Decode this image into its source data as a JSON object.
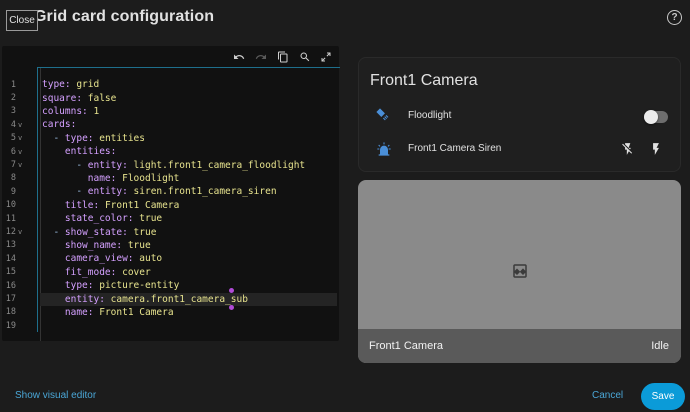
{
  "dialog": {
    "title": "Grid card configuration",
    "close_label": "Close",
    "help_icon": "help-circle-icon"
  },
  "editor": {
    "toolbar_icons": [
      "undo-icon",
      "redo-icon",
      "copy-icon",
      "search-icon",
      "fullscreen-icon"
    ],
    "lines": [
      {
        "n": "1",
        "fold": "",
        "parts": [
          [
            "k",
            "type: "
          ],
          [
            "v",
            "grid"
          ]
        ]
      },
      {
        "n": "2",
        "fold": "",
        "parts": [
          [
            "k",
            "square: "
          ],
          [
            "v",
            "false"
          ]
        ]
      },
      {
        "n": "3",
        "fold": "",
        "parts": [
          [
            "k",
            "columns: "
          ],
          [
            "v",
            "1"
          ]
        ]
      },
      {
        "n": "4",
        "fold": "v",
        "parts": [
          [
            "k",
            "cards:"
          ]
        ]
      },
      {
        "n": "5",
        "fold": "v",
        "parts": [
          [
            "s",
            "  "
          ],
          [
            "d",
            "- "
          ],
          [
            "k",
            "type: "
          ],
          [
            "v",
            "entities"
          ]
        ]
      },
      {
        "n": "6",
        "fold": "v",
        "parts": [
          [
            "s",
            "    "
          ],
          [
            "k",
            "entities:"
          ]
        ]
      },
      {
        "n": "7",
        "fold": "v",
        "parts": [
          [
            "s",
            "      "
          ],
          [
            "d",
            "- "
          ],
          [
            "k",
            "entity: "
          ],
          [
            "v",
            "light.front1_camera_floodlight"
          ]
        ]
      },
      {
        "n": "8",
        "fold": "",
        "parts": [
          [
            "s",
            "        "
          ],
          [
            "k",
            "name: "
          ],
          [
            "v",
            "Floodlight"
          ]
        ]
      },
      {
        "n": "9",
        "fold": "",
        "parts": [
          [
            "s",
            "      "
          ],
          [
            "d",
            "- "
          ],
          [
            "k",
            "entity: "
          ],
          [
            "v",
            "siren.front1_camera_siren"
          ]
        ]
      },
      {
        "n": "10",
        "fold": "",
        "parts": [
          [
            "s",
            "    "
          ],
          [
            "k",
            "title: "
          ],
          [
            "v",
            "Front1 Camera"
          ]
        ]
      },
      {
        "n": "11",
        "fold": "",
        "parts": [
          [
            "s",
            "    "
          ],
          [
            "k",
            "state_color: "
          ],
          [
            "v",
            "true"
          ]
        ]
      },
      {
        "n": "12",
        "fold": "v",
        "parts": [
          [
            "s",
            "  "
          ],
          [
            "d",
            "- "
          ],
          [
            "k",
            "show_state: "
          ],
          [
            "v",
            "true"
          ]
        ]
      },
      {
        "n": "13",
        "fold": "",
        "parts": [
          [
            "s",
            "    "
          ],
          [
            "k",
            "show_name: "
          ],
          [
            "v",
            "true"
          ]
        ]
      },
      {
        "n": "14",
        "fold": "",
        "parts": [
          [
            "s",
            "    "
          ],
          [
            "k",
            "camera_view: "
          ],
          [
            "v",
            "auto"
          ]
        ]
      },
      {
        "n": "15",
        "fold": "",
        "parts": [
          [
            "s",
            "    "
          ],
          [
            "k",
            "fit_mode: "
          ],
          [
            "v",
            "cover"
          ]
        ]
      },
      {
        "n": "16",
        "fold": "",
        "parts": [
          [
            "s",
            "    "
          ],
          [
            "k",
            "type: "
          ],
          [
            "v",
            "picture-entity"
          ]
        ]
      },
      {
        "n": "17",
        "fold": "",
        "parts": [
          [
            "s",
            "    "
          ],
          [
            "k",
            "entity: "
          ],
          [
            "v",
            "camera.front1_camera_sub"
          ]
        ]
      },
      {
        "n": "18",
        "fold": "",
        "parts": [
          [
            "s",
            "    "
          ],
          [
            "k",
            "name: "
          ],
          [
            "v",
            "Front1 Camera"
          ]
        ]
      },
      {
        "n": "19",
        "fold": "",
        "parts": []
      }
    ]
  },
  "preview": {
    "entities_card": {
      "title": "Front1 Camera",
      "rows": [
        {
          "name": "Floodlight",
          "icon": "floodlight-icon",
          "toggle_on": false
        },
        {
          "name": "Front1 Camera Siren",
          "icon": "alarm-light-icon",
          "actions": [
            "flash-off-icon",
            "flash-icon"
          ]
        }
      ]
    },
    "picture_card": {
      "name": "Front1 Camera",
      "state": "Idle",
      "icon": "image-broken-icon"
    }
  },
  "footer": {
    "show_visual_editor": "Show visual editor",
    "cancel": "Cancel",
    "save": "Save"
  },
  "colors": {
    "accent": "#0b9bd8",
    "link": "#4aa6d6",
    "background": "#1c1c1c"
  }
}
